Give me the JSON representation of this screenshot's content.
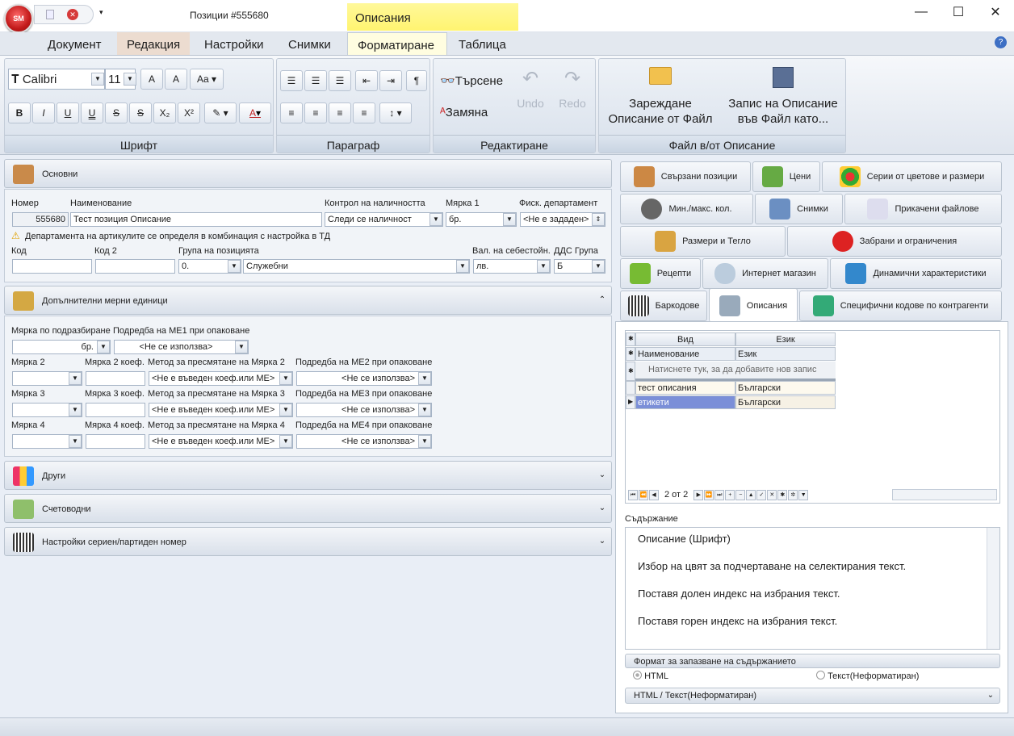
{
  "window": {
    "title": "Позиции #555680",
    "context_tab": "Описания"
  },
  "app_logo": "SM",
  "menu": [
    "Документ",
    "Редакция",
    "Настройки",
    "Снимки",
    "Форматиране",
    "Таблица"
  ],
  "ribbon": {
    "font": {
      "name": "Calibri",
      "size": "11",
      "label": "Шрифт",
      "buttons": [
        "B",
        "I",
        "U",
        "U",
        "S",
        "S",
        "X₂",
        "X²"
      ]
    },
    "paragraph": {
      "label": "Параграф"
    },
    "edit": {
      "search": "Търсене",
      "replace": "Замяна",
      "undo": "Undo",
      "redo": "Redo",
      "label": "Редактиране"
    },
    "file": {
      "load": "Зареждане\nОписание от Файл",
      "save": "Запис на Описание\nвъв Файл като...",
      "label": "Файл в/от Описание"
    }
  },
  "basics": {
    "header": "Основни",
    "labels": {
      "number": "Номер",
      "name": "Наименование",
      "stock": "Контрол на наличността",
      "unit1": "Мярка 1",
      "fiscal": "Фиск. департамент",
      "code": "Код",
      "code2": "Код 2",
      "group": "Група на позицията",
      "currency": "Вал. на себестойн.",
      "vat": "ДДС Група"
    },
    "values": {
      "number": "555680",
      "name": "Тест позиция Описание",
      "stock": "Следи се наличност",
      "unit1": "бр.",
      "fiscal": "<Не е зададен>",
      "group_num": "0.",
      "group": "Служебни",
      "currency": "лв.",
      "vat": "Б"
    },
    "warning": "Департамента на артикулите се определя в комбинация с настройка в ТД"
  },
  "units": {
    "header": "Допълнителни мерни единици",
    "default_unit_label": "Мярка по подразбиране",
    "order_me1_label": "Подредба на МЕ1 при опаковане",
    "default_unit": "бр.",
    "order_me1": "<Не се използва>",
    "rows": [
      {
        "unit": "Мярка 2",
        "coef": "Мярка 2 коеф.",
        "method": "Метод за пресмятане на Мярка 2",
        "order": "Подредба на МЕ2 при опаковане"
      },
      {
        "unit": "Мярка 3",
        "coef": "Мярка 3 коеф.",
        "method": "Метод за пресмятане на Мярка 3",
        "order": "Подредба на МЕ3 при опаковане"
      },
      {
        "unit": "Мярка 4",
        "coef": "Мярка 4 коеф.",
        "method": "Метод за пресмятане на Мярка 4",
        "order": "Подредба на МЕ4 при опаковане"
      }
    ],
    "method_value": "<Не е въведен коеф.или МЕ>",
    "order_value": "<Не се използва>"
  },
  "collapsed": [
    "Други",
    "Счетоводни",
    "Настройки сериен/партиден номер"
  ],
  "right_tabs": {
    "row1": [
      "Свързани позиции",
      "Цени",
      "Серии от цветове и размери"
    ],
    "row2": [
      "Мин./макс. кол.",
      "Снимки",
      "Прикачени файлове"
    ],
    "row3": [
      "Размери и Тегло",
      "Забрани и ограничения"
    ],
    "row4": [
      "Рецепти",
      "Интернет магазин",
      "Динамични характеристики"
    ],
    "row5": [
      "Баркодове",
      "Описания",
      "Специфични кодове по контрагенти"
    ]
  },
  "grid": {
    "headers": [
      "Вид",
      "Език"
    ],
    "filter": [
      "Наименование",
      "Език"
    ],
    "new_row": "Натиснете тук, за да добавите нов запис",
    "rows": [
      [
        "тест описания",
        "Български"
      ],
      [
        "етикети",
        "Български"
      ]
    ],
    "nav": "2 от 2"
  },
  "content": {
    "label": "Съдържание",
    "lines": [
      "Описание (Шрифт)",
      "Избор на цвят за подчертаване на селектирания текст.",
      "Поставя долен индекс на избрания текст.",
      "Поставя горен индекс на избрания текст."
    ]
  },
  "format": {
    "label": "Формат за запазване на съдържанието",
    "html": "HTML",
    "text": "Текст(Неформатиран)",
    "footer": "HTML / Текст(Неформатиран)"
  }
}
